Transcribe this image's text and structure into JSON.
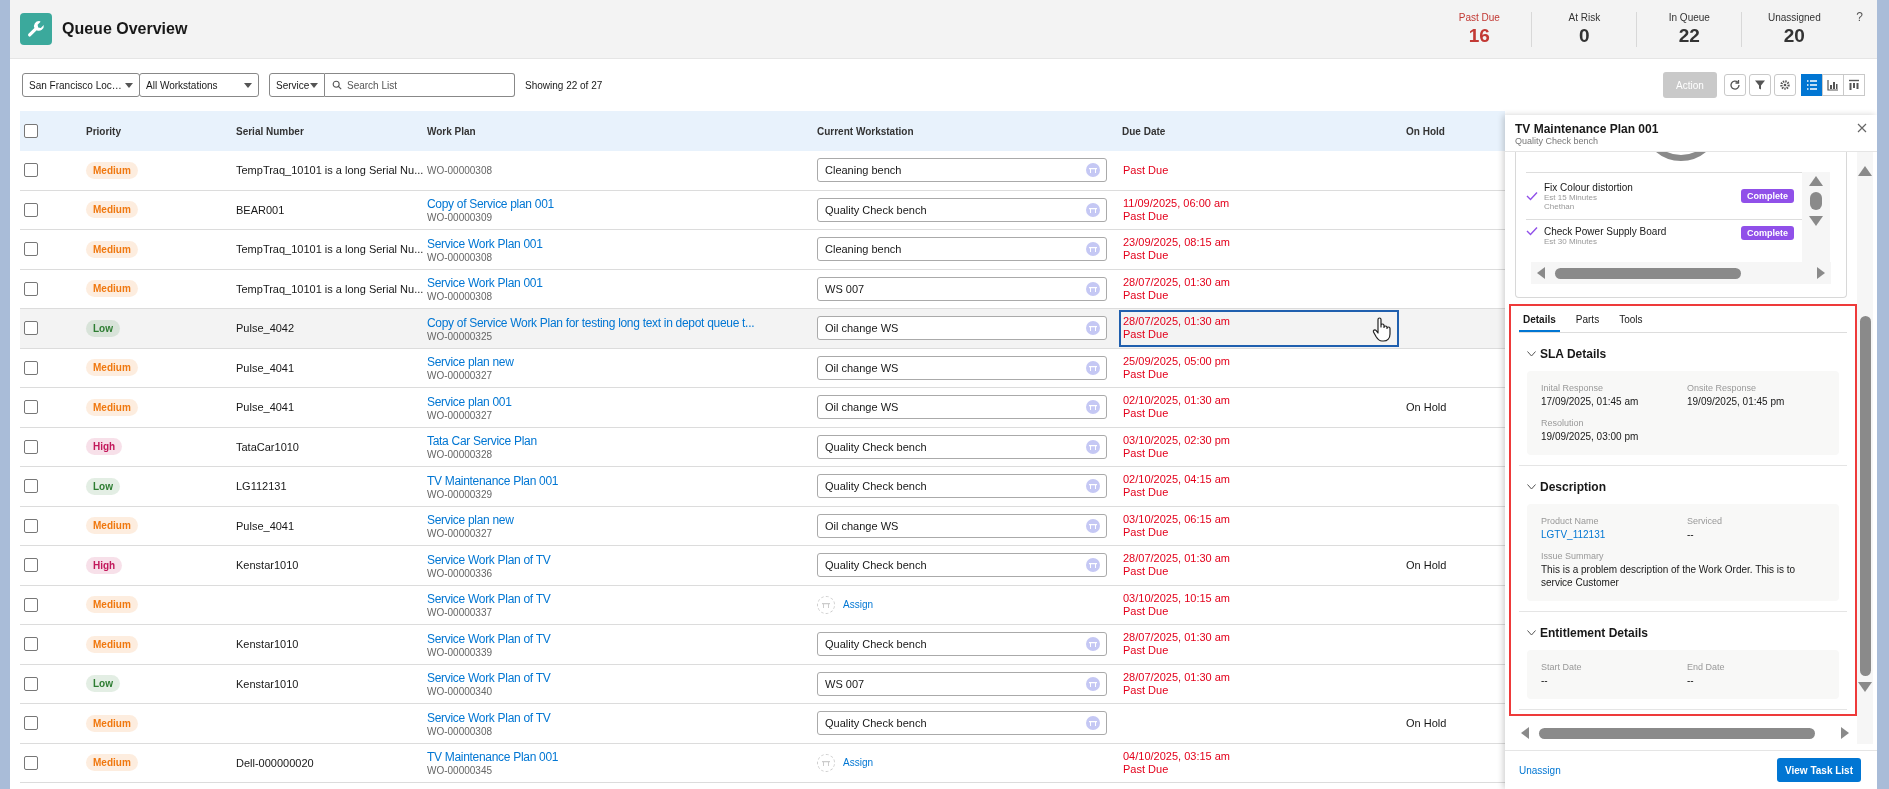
{
  "app": {
    "title": "Queue Overview"
  },
  "stats": [
    {
      "label": "Past Due",
      "value": "16",
      "kind": "alert"
    },
    {
      "label": "At Risk",
      "value": "0",
      "kind": "normal"
    },
    {
      "label": "In Queue",
      "value": "22",
      "kind": "normal"
    },
    {
      "label": "Unassigned",
      "value": "20",
      "kind": "normal"
    }
  ],
  "help": "?",
  "toolbar": {
    "filters": [
      {
        "value": "San Francisco Loc…"
      },
      {
        "value": "All Workstations"
      }
    ],
    "search": {
      "scope": "Service",
      "placeholder": "Search List"
    },
    "count": "Showing 22 of 27",
    "action": {
      "label": "Action",
      "disabled": true
    },
    "views": [
      {
        "kind": "list",
        "selected": true
      },
      {
        "kind": "chart",
        "selected": false
      },
      {
        "kind": "columns",
        "selected": false
      }
    ]
  },
  "table": {
    "all_checked": false,
    "columns": [
      "Priority",
      "Serial Number",
      "Work Plan",
      "Current Workstation",
      "Due Date",
      "On Hold"
    ],
    "rows": [
      {
        "checked": false,
        "selected": false,
        "focused": false,
        "priority": "Medium",
        "color": "#f0780f",
        "serial": "TempTraq_10101 is a long Serial Nu...",
        "work_order": "WO-00000308",
        "workstation": {
          "kind": "field",
          "value": "Cleaning bench"
        },
        "due": {
          "status": "Past Due",
          "overdue": true
        }
      },
      {
        "checked": false,
        "selected": false,
        "focused": false,
        "priority": "Medium",
        "color": "#f0780f",
        "serial": "BEAR001",
        "work_plan": "Copy of Service plan 001",
        "work_order": "WO-00000309",
        "workstation": {
          "kind": "field",
          "value": "Quality Check bench"
        },
        "due": {
          "date": "11/09/2025, 06:00 am",
          "status": "Past Due",
          "overdue": true
        }
      },
      {
        "checked": false,
        "selected": false,
        "focused": false,
        "priority": "Medium",
        "color": "#f0780f",
        "serial": "TempTraq_10101 is a long Serial Nu...",
        "work_plan": "Service Work Plan 001",
        "work_order": "WO-00000308",
        "workstation": {
          "kind": "field",
          "value": "Cleaning bench"
        },
        "due": {
          "date": "23/09/2025, 08:15 am",
          "status": "Past Due",
          "overdue": true
        }
      },
      {
        "checked": false,
        "selected": false,
        "focused": false,
        "priority": "Medium",
        "color": "#f0780f",
        "serial": "TempTraq_10101 is a long Serial Nu...",
        "work_plan": "Service Work Plan 001",
        "work_order": "WO-00000308",
        "workstation": {
          "kind": "field",
          "value": "WS 007"
        },
        "due": {
          "date": "28/07/2025, 01:30 am",
          "status": "Past Due",
          "overdue": true
        }
      },
      {
        "checked": false,
        "selected": true,
        "focused": true,
        "priority": "Low",
        "color": "#2e7d32",
        "serial": "Pulse_4042",
        "work_plan": "Copy of Service Work Plan for testing long text in depot queue t...",
        "work_order": "WO-00000325",
        "workstation": {
          "kind": "field",
          "value": "Oil change WS"
        },
        "due": {
          "date": "28/07/2025, 01:30 am",
          "status": "Past Due",
          "overdue": true
        }
      },
      {
        "checked": false,
        "selected": false,
        "focused": false,
        "priority": "Medium",
        "color": "#f0780f",
        "serial": "Pulse_4041",
        "work_plan": "Service plan new",
        "work_order": "WO-00000327",
        "workstation": {
          "kind": "field",
          "value": "Oil change WS"
        },
        "due": {
          "date": "25/09/2025, 05:00 pm",
          "status": "Past Due",
          "overdue": true
        }
      },
      {
        "checked": false,
        "selected": false,
        "focused": false,
        "priority": "Medium",
        "color": "#f0780f",
        "serial": "Pulse_4041",
        "work_plan": "Service plan 001",
        "work_order": "WO-00000327",
        "workstation": {
          "kind": "field",
          "value": "Oil change WS"
        },
        "due": {
          "date": "02/10/2025, 01:30 am",
          "status": "Past Due",
          "overdue": true
        },
        "on_hold": "On Hold"
      },
      {
        "checked": false,
        "selected": false,
        "focused": false,
        "priority": "High",
        "color": "#c2185b",
        "serial": "TataCar1010",
        "work_plan": "Tata Car Service Plan",
        "work_order": "WO-00000328",
        "workstation": {
          "kind": "field",
          "value": "Quality Check bench"
        },
        "due": {
          "date": "03/10/2025, 02:30 pm",
          "status": "Past Due",
          "overdue": true
        }
      },
      {
        "checked": false,
        "selected": false,
        "focused": false,
        "priority": "Low",
        "color": "#2e7d32",
        "serial": "LG112131",
        "work_plan": "TV Maintenance Plan 001",
        "work_order": "WO-00000329",
        "workstation": {
          "kind": "field",
          "value": "Quality Check bench"
        },
        "due": {
          "date": "02/10/2025, 04:15 am",
          "status": "Past Due",
          "overdue": true
        }
      },
      {
        "checked": false,
        "selected": false,
        "focused": false,
        "priority": "Medium",
        "color": "#f0780f",
        "serial": "Pulse_4041",
        "work_plan": "Service plan new",
        "work_order": "WO-00000327",
        "workstation": {
          "kind": "field",
          "value": "Oil change WS"
        },
        "due": {
          "date": "03/10/2025, 06:15 am",
          "status": "Past Due",
          "overdue": true
        }
      },
      {
        "checked": false,
        "selected": false,
        "focused": false,
        "priority": "High",
        "color": "#c2185b",
        "serial": "Kenstar1010",
        "work_plan": "Service Work Plan of TV",
        "work_order": "WO-00000336",
        "workstation": {
          "kind": "field",
          "value": "Quality Check bench"
        },
        "due": {
          "date": "28/07/2025, 01:30 am",
          "status": "Past Due",
          "overdue": true
        },
        "on_hold": "On Hold"
      },
      {
        "checked": false,
        "selected": false,
        "focused": false,
        "priority": "Medium",
        "color": "#f0780f",
        "work_plan": "Service Work Plan of TV",
        "work_order": "WO-00000337",
        "workstation": {
          "kind": "assign",
          "label": "Assign"
        },
        "due": {
          "date": "03/10/2025, 10:15 am",
          "status": "Past Due",
          "overdue": true
        }
      },
      {
        "checked": false,
        "selected": false,
        "focused": false,
        "priority": "Medium",
        "color": "#f0780f",
        "serial": "Kenstar1010",
        "work_plan": "Service Work Plan of TV",
        "work_order": "WO-00000339",
        "workstation": {
          "kind": "field",
          "value": "Quality Check bench"
        },
        "due": {
          "date": "28/07/2025, 01:30 am",
          "status": "Past Due",
          "overdue": true
        }
      },
      {
        "checked": false,
        "selected": false,
        "focused": false,
        "priority": "Low",
        "color": "#2e7d32",
        "serial": "Kenstar1010",
        "work_plan": "Service Work Plan of TV",
        "work_order": "WO-00000340",
        "workstation": {
          "kind": "field",
          "value": "WS 007"
        },
        "due": {
          "date": "28/07/2025, 01:30 am",
          "status": "Past Due",
          "overdue": true
        }
      },
      {
        "checked": false,
        "selected": false,
        "focused": false,
        "priority": "Medium",
        "color": "#f0780f",
        "work_plan": "Service Work Plan of TV",
        "work_order": "WO-00000308",
        "workstation": {
          "kind": "field",
          "value": "Quality Check bench"
        },
        "on_hold": "On Hold"
      },
      {
        "checked": false,
        "selected": false,
        "focused": false,
        "priority": "Medium",
        "color": "#f0780f",
        "serial": "Dell-000000020",
        "work_plan": "TV Maintenance Plan 001",
        "work_order": "WO-00000345",
        "workstation": {
          "kind": "assign",
          "label": "Assign"
        },
        "due": {
          "date": "04/10/2025, 03:15 am",
          "status": "Past Due",
          "overdue": true
        }
      }
    ]
  },
  "panel": {
    "title": "TV Maintenance Plan 001",
    "subtitle": "Quality Check bench",
    "tasks": [
      {
        "name": "Fix Colour distortion",
        "estimate": "Est 15 Minutes",
        "assignee": "Chethan",
        "done": true,
        "status": "Complete"
      },
      {
        "name": "Check Power Supply Board",
        "estimate": "Est 30 Minutes",
        "done": true,
        "status": "Complete"
      }
    ],
    "tabs": [
      {
        "label": "Details",
        "selected": true
      },
      {
        "label": "Parts",
        "selected": false
      },
      {
        "label": "Tools",
        "selected": false
      }
    ],
    "sections": [
      {
        "title": "SLA Details",
        "expanded": true,
        "fields": [
          {
            "label": "Inital Response",
            "value": "17/09/2025, 01:45 am",
            "kind": "text"
          },
          {
            "label": "Onsite Response",
            "value": "19/09/2025, 01:45 pm",
            "kind": "text"
          },
          {
            "label": "Resolution",
            "value": "19/09/2025, 03:00 pm",
            "kind": "text"
          }
        ]
      },
      {
        "title": "Description",
        "expanded": true,
        "fields": [
          {
            "label": "Product Name",
            "value": "LGTV_112131",
            "kind": "link"
          },
          {
            "label": "Serviced",
            "value": "--",
            "kind": "text"
          },
          {
            "label": "Issue Summary",
            "value": "This is a problem description of the Work Order. This is to service Customer",
            "kind": "wide"
          }
        ]
      },
      {
        "title": "Entitlement Details",
        "expanded": true,
        "fields": [
          {
            "label": "Start Date",
            "value": "--",
            "kind": "text"
          },
          {
            "label": "End Date",
            "value": "--",
            "kind": "text"
          }
        ]
      }
    ],
    "footer": {
      "link": "Unassign",
      "button": "View Task List"
    }
  }
}
